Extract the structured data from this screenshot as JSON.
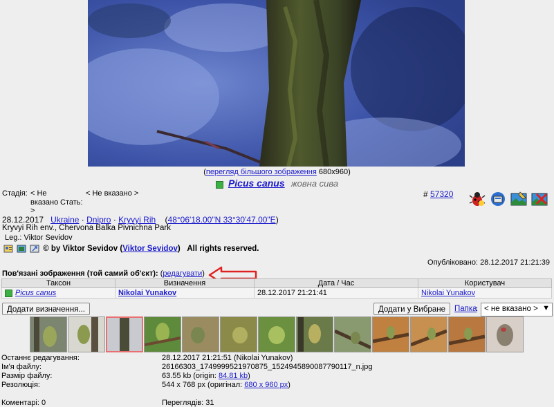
{
  "caption": {
    "prefix": "(",
    "link": "перегляд більшого зображення",
    "size": "680x960",
    "suffix": ")"
  },
  "species": {
    "latin": "Picus canus",
    "local": "жовна сива"
  },
  "meta": {
    "stage_label": "Стадія:",
    "stage_value_line1": "< Не",
    "stage_value_line2": "вказано",
    "stage_value_line3": ">",
    "sex_label": "Стать:",
    "sex_value": "< Не вказано >",
    "id_hash": "#",
    "id_link": "57320",
    "date": "28.12.2017",
    "loc_country": "Ukraine",
    "loc_region": "Dnipro",
    "loc_city": "Kryvyi Rih",
    "loc_sep": "·",
    "coords": "48°06'18.00\"N 33°30'47.00\"E",
    "place": "Kryvyi Rih env., Chervona Balka Pivnichna Park",
    "leg_label": "Leg.:",
    "leg_value": "Viktor Sevidov",
    "copyright_prefix": "© by Viktor Sevidov (",
    "copyright_link": "Viktor Sevidov",
    "copyright_suffix": ")",
    "rights": "All rights reserved.",
    "published_label": "Опубліковано:",
    "published_value": "28.12.2017 21:21:39"
  },
  "related": {
    "title": "Пов'язані зображення (той самий об'єкт):",
    "edit_link": "редагувати",
    "columns": [
      "Таксон",
      "Визначення",
      "Дата / Час",
      "Користувач"
    ],
    "row": {
      "taxon": "Picus canus",
      "ident": "Nikolai Yunakov",
      "datetime": "28.12.2017 21:21:41",
      "user": "Nikolai Yunakov"
    }
  },
  "buttons": {
    "add_ident": "Додати визначення...",
    "add_fav": "Додати у Вибране",
    "folder_label": "Папка",
    "folder_value": "< не вказано >"
  },
  "info": {
    "last_edit_label": "Останнє редагування:",
    "last_edit_value": "28.12.2017 21:21:51 (Nikolai Yunakov)",
    "filename_label": "Ім'я файлу:",
    "filename_value": "26166303_1749999521970875_1524945890087790117_n.jpg",
    "filesize_label": "Размір файлу:",
    "filesize_prefix": "63.55 kb (origin:",
    "filesize_link": "84.81 kb",
    "filesize_suffix": ")",
    "resolution_label": "Резолюція:",
    "resolution_prefix": "544 x 768 px (оригінал:",
    "resolution_link": "680 x 960 px",
    "resolution_suffix": ")",
    "comments_label": "Коментарі:",
    "comments_value": "0",
    "views_label": "Переглядів:",
    "views_value": "31"
  },
  "colors": {
    "link": "#1a1acc",
    "status_green": "#3cb043",
    "arrow_red": "#e02020"
  }
}
